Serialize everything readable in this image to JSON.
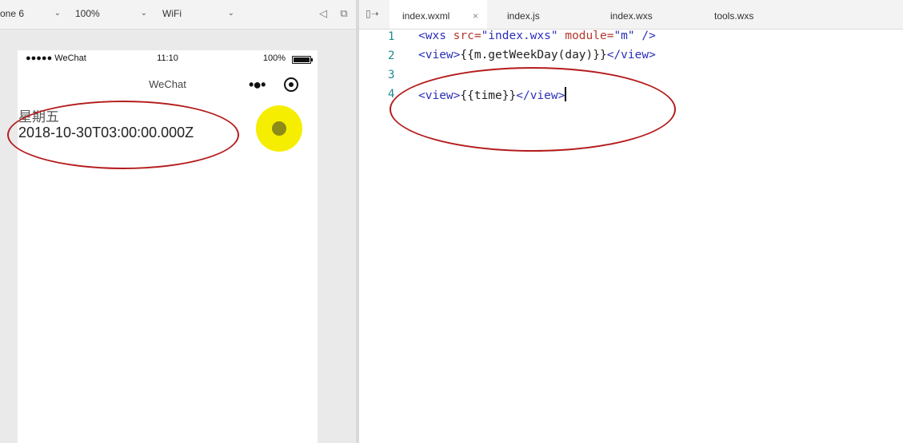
{
  "simulator": {
    "device_select": "one 6",
    "zoom_select": "100%",
    "network_select": "WiFi",
    "phone": {
      "status_bar": {
        "signal": "●●●●● WeChat",
        "time": "11:10",
        "battery": "100%"
      },
      "nav_title": "WeChat",
      "capsule_more": "•●•",
      "content": {
        "weekday": "星期五",
        "time": "2018-10-30T03:00:00.000Z"
      }
    }
  },
  "editor": {
    "tabs": [
      {
        "label": "index.wxml",
        "active": true,
        "close": "×"
      },
      {
        "label": "index.js",
        "active": false
      },
      {
        "label": "index.wxs",
        "active": false
      },
      {
        "label": "tools.wxs",
        "active": false
      }
    ],
    "line_numbers": [
      "1",
      "2",
      "3",
      "4"
    ],
    "code": {
      "l1_tag_open": "<wxs ",
      "l1_attr_src": "src=",
      "l1_val_src": "\"index.wxs\"",
      "l1_attr_module": " module=",
      "l1_val_module": "\"m\"",
      "l1_tag_close": " />",
      "l2_open": "<view>",
      "l2_text": "{{m.getWeekDay(day)}}",
      "l2_close": "</view>",
      "l4_open": "<view>",
      "l4_text": "{{time}}",
      "l4_close": "</view>"
    }
  },
  "colors": {
    "annotation": "#b51c1c",
    "cursor_highlight": "#f6ee00",
    "tag": "#2b2fb8",
    "attr": "#b4362d",
    "line_number": "#1e8a8a"
  }
}
